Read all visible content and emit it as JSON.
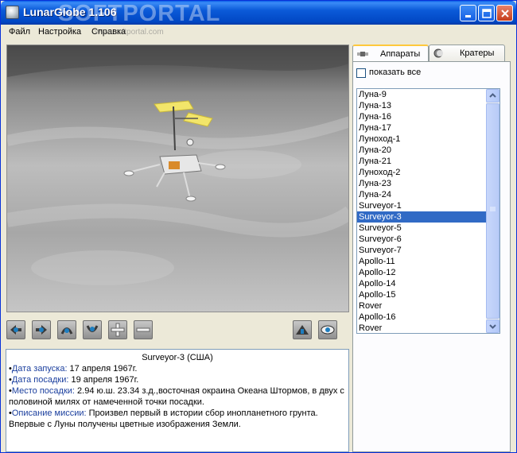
{
  "window": {
    "title": "LunarGlobe 1.106",
    "watermark": "SOFTPORTAL",
    "watermark_url": "www.softportal.com",
    "buttons": [
      "minimize",
      "maximize",
      "close"
    ]
  },
  "menu": {
    "items": [
      "Файл",
      "Настройка",
      "Справка"
    ]
  },
  "toolbar": {
    "left_icons": [
      "rotate-left-icon",
      "rotate-right-icon",
      "tilt-up-icon",
      "tilt-down-icon",
      "zoom-in-icon",
      "zoom-out-icon"
    ],
    "right_icons": [
      "reset-view-icon",
      "eye-icon"
    ]
  },
  "info": {
    "title": "Surveyor-3 (США)",
    "launch_label": "Дата запуска:",
    "launch_value": " 17 апреля 1967г.",
    "landing_label": "Дата посадки:",
    "landing_value": " 19 апреля 1967г.",
    "site_label": "Место посадки:",
    "site_value": "   2.94 ю.ш. 23.34 з.д.,восточная окраина Океана Штормов, в двух с половиной милях от намеченной точки посадки.",
    "mission_label": "Описание миссии:",
    "mission_value": " Произвел первый в истории сбор инопланетного грунта. Впервые с Луны получены цветные изображения Земли."
  },
  "tabs": [
    {
      "label": "Аппараты",
      "icon": "satellite-icon",
      "active": true
    },
    {
      "label": "Кратеры",
      "icon": "moon-icon",
      "active": false
    }
  ],
  "panel": {
    "show_all_label": "показать все",
    "show_all_checked": false,
    "items": [
      "Луна-9",
      "Луна-13",
      "Луна-16",
      "Луна-17",
      "Луноход-1",
      "Луна-20",
      "Луна-21",
      "Луноход-2",
      "Луна-23",
      "Луна-24",
      "Surveyor-1",
      "Surveyor-3",
      "Surveyor-5",
      "Surveyor-6",
      "Surveyor-7",
      "Apollo-11",
      "Apollo-12",
      "Apollo-14",
      "Apollo-15",
      "Rover",
      "Apollo-16",
      "Rover"
    ],
    "selected_index": 11
  },
  "colors": {
    "titlebar": "#0b5ad8",
    "selection": "#316ac5",
    "label_blue": "#1b3f9e"
  }
}
